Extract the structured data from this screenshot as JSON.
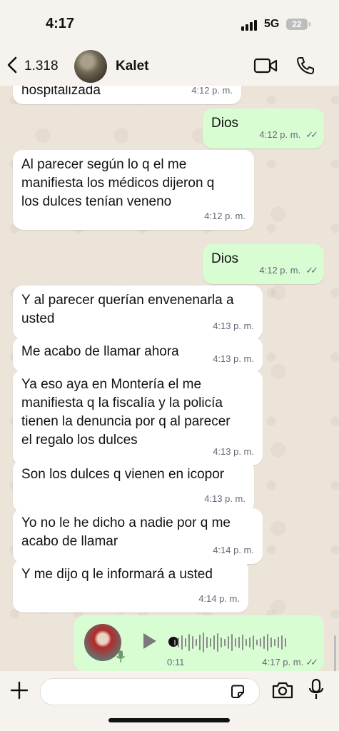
{
  "status_bar": {
    "time": "4:17",
    "network": "5G",
    "battery": "22"
  },
  "header": {
    "back_count": "1.318",
    "contact_name": "Kalet"
  },
  "messages": [
    {
      "dir": "in",
      "text": "hospitalizada",
      "time": "4:12 p. m."
    },
    {
      "dir": "out",
      "text": "Dios",
      "time": "4:12 p. m."
    },
    {
      "dir": "in",
      "text": "Al parecer según lo q el me\nmanifiesta los médicos dijeron q\nlos dulces tenían veneno",
      "time": "4:12 p. m."
    },
    {
      "dir": "out",
      "text": "Dios",
      "time": "4:12 p. m."
    },
    {
      "dir": "in",
      "text": "Y al parecer querían envenenarla a\nusted",
      "time": "4:13 p. m."
    },
    {
      "dir": "in",
      "text": "Me acabo de llamar ahora",
      "time": "4:13 p. m."
    },
    {
      "dir": "in",
      "text": "Ya eso aya en Montería el me\nmanifiesta q la fiscalía y la policía\ntienen la denuncia por q al parecer\nel regalo los dulces",
      "time": "4:13 p. m."
    },
    {
      "dir": "in",
      "text": "Son los dulces q vienen en icopor",
      "time": "4:13 p. m."
    },
    {
      "dir": "in",
      "text": "Yo no le he dicho a nadie por q me\nacabo de llamar",
      "time": "4:14 p. m."
    },
    {
      "dir": "in",
      "text": "Y me dijo q le informará a usted",
      "time": "4:14 p. m."
    }
  ],
  "voice_note": {
    "duration": "0:11",
    "time": "4:17 p. m."
  },
  "icons": {
    "back": "chevron-left-icon",
    "video": "video-camera-icon",
    "phone": "phone-icon",
    "plus": "plus-icon",
    "sticker": "sticker-icon",
    "camera": "camera-icon",
    "mic": "microphone-icon",
    "read": "double-check-icon"
  },
  "colors": {
    "incoming_bubble": "#ffffff",
    "outgoing_bubble": "#d9fdd3",
    "chat_background": "#ece4d9"
  }
}
